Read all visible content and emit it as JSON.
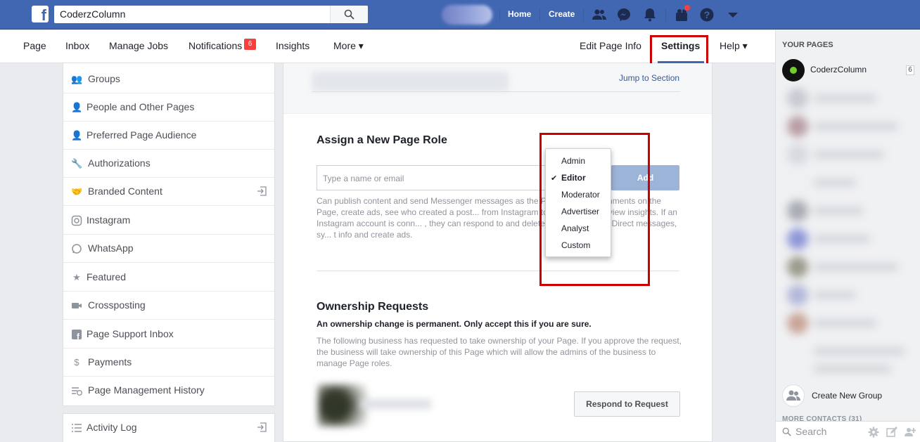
{
  "topbar": {
    "search_value": "CoderzColumn",
    "nav_home": "Home",
    "nav_create": "Create",
    "brand_color": "#4267b2"
  },
  "page_nav": {
    "items": [
      "Page",
      "Inbox",
      "Manage Jobs",
      "Notifications",
      "Insights",
      "More ▾"
    ],
    "notifications_badge": "6",
    "edit_page_info": "Edit Page Info",
    "settings": "Settings",
    "help": "Help ▾"
  },
  "left_menu": {
    "items": [
      {
        "label": "Groups",
        "icon": "groups-icon"
      },
      {
        "label": "People and Other Pages",
        "icon": "people-icon"
      },
      {
        "label": "Preferred Page Audience",
        "icon": "audience-icon"
      },
      {
        "label": "Authorizations",
        "icon": "wrench-icon"
      },
      {
        "label": "Branded Content",
        "icon": "handshake-icon"
      },
      {
        "label": "Instagram",
        "icon": "instagram-icon"
      },
      {
        "label": "WhatsApp",
        "icon": "whatsapp-icon"
      },
      {
        "label": "Featured",
        "icon": "star-icon"
      },
      {
        "label": "Crossposting",
        "icon": "video-icon"
      },
      {
        "label": "Page Support Inbox",
        "icon": "facebook-icon"
      },
      {
        "label": "Payments",
        "icon": "dollar-icon"
      },
      {
        "label": "Page Management History",
        "icon": "history-icon"
      }
    ],
    "activity_log": "Activity Log"
  },
  "main": {
    "jump_to_section": "Jump to Section",
    "assign_title": "Assign a New Page Role",
    "name_placeholder": "Type a name or email",
    "add_button": "Add",
    "role_description": "Can publish content and send Messenger messages as the P... and delete comments on the Page, create ads, see who created a post... from Instagram to Facebook, and view insights. If an Instagram account is conn... , they can respond to and delete comments, send Direct messages, sy... t info and create ads.",
    "ownership_title": "Ownership Requests",
    "ownership_warning": "An ownership change is permanent. Only accept this if you are sure.",
    "ownership_description": "The following business has requested to take ownership of your Page. If you approve the request, the business will take ownership of this Page which will allow the admins of the business to manage Page roles.",
    "respond_button": "Respond to Request"
  },
  "role_dropdown": {
    "options": [
      "Admin",
      "Editor",
      "Moderator",
      "Advertiser",
      "Analyst",
      "Custom"
    ],
    "selected": "Editor"
  },
  "right_col": {
    "title": "YOUR PAGES",
    "page_name": "CoderzColumn",
    "page_count": "6",
    "create_group": "Create New Group",
    "more_contacts": "MORE CONTACTS (31)",
    "search_label": "Search"
  },
  "highlight_color": "#cc0000"
}
